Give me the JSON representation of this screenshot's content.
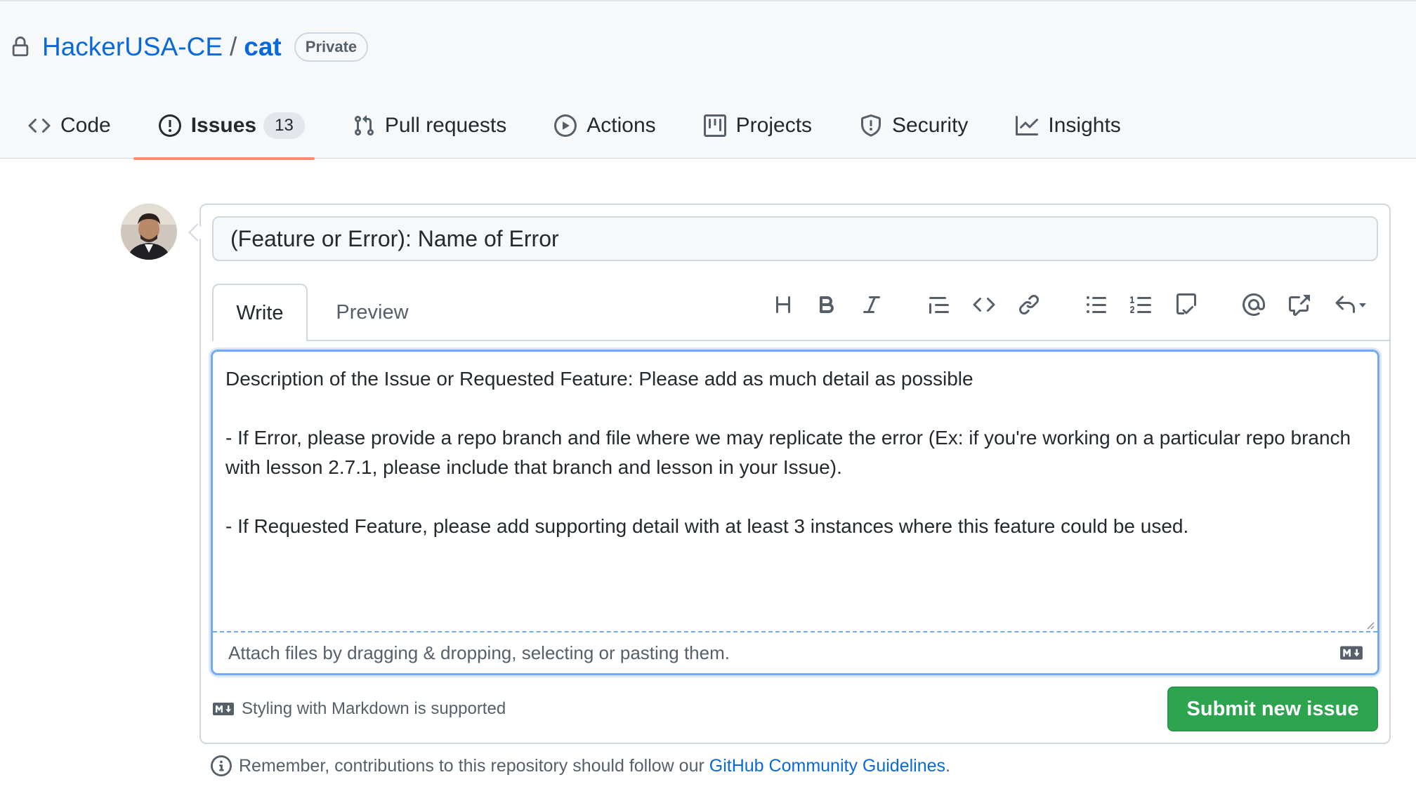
{
  "repo": {
    "owner": "HackerUSA-CE",
    "separator": "/",
    "name": "cat",
    "visibility": "Private"
  },
  "tabs": [
    {
      "label": "Code",
      "icon": "code-icon"
    },
    {
      "label": "Issues",
      "icon": "issue-opened-icon",
      "count": "13",
      "active": true
    },
    {
      "label": "Pull requests",
      "icon": "git-pull-request-icon"
    },
    {
      "label": "Actions",
      "icon": "play-icon"
    },
    {
      "label": "Projects",
      "icon": "project-icon"
    },
    {
      "label": "Security",
      "icon": "shield-icon"
    },
    {
      "label": "Insights",
      "icon": "graph-icon"
    }
  ],
  "form": {
    "title_value": "(Feature or Error): Name of Error",
    "write_tab": "Write",
    "preview_tab": "Preview",
    "toolbar": [
      "heading-icon",
      "bold-icon",
      "italic-icon",
      "quote-icon",
      "code-icon",
      "link-icon",
      "unordered-list-icon",
      "ordered-list-icon",
      "task-list-icon",
      "mention-icon",
      "cross-reference-icon",
      "reply-icon"
    ],
    "body_line1": "Description of the Issue or Requested Feature: Please add as much detail as possible",
    "body_line2": "- If Error, please provide a repo branch and file where we may replicate the error (Ex: if you're working on a particular repo branch with lesson 2.7.1, please include that branch and lesson in your Issue).",
    "body_line3": "- If Requested Feature, please add supporting detail with at least 3 instances where this feature could be used.",
    "attach_hint": "Attach files by dragging & dropping, selecting or pasting them.",
    "markdown_note": "Styling with Markdown is supported",
    "submit_label": "Submit new issue"
  },
  "footer": {
    "remember_text": "Remember, contributions to this repository should follow our",
    "guidelines_link": "GitHub Community Guidelines",
    "period": "."
  },
  "colors": {
    "accent": "#0969da",
    "submit": "#2da44e",
    "active_tab_underline": "#fd8c73",
    "editor_focus": "#74a9f4"
  }
}
